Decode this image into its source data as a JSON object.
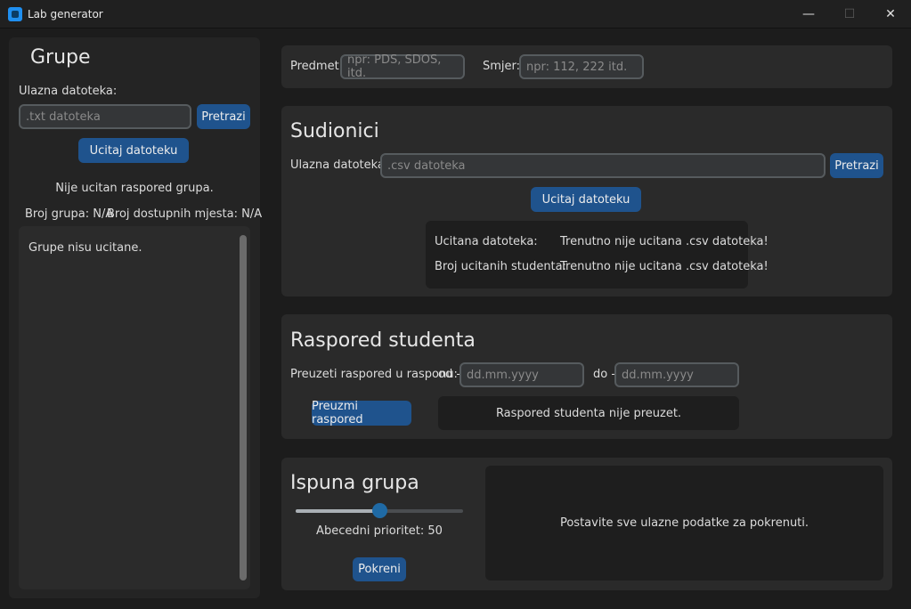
{
  "window": {
    "title": "Lab generator",
    "buttons": {
      "minimize": "—",
      "maximize": "☐",
      "close": "✕"
    }
  },
  "grupe": {
    "title": "Grupe",
    "input_label": "Ulazna datoteka:",
    "input_placeholder": ".txt datoteka",
    "browse_label": "Pretrazi",
    "load_label": "Ucitaj datoteku",
    "status": "Nije ucitan raspored grupa.",
    "count_groups": "Broj grupa: N/A",
    "count_slots": "Broj dostupnih mjesta: N/A",
    "list_text": "Grupe nisu ucitane."
  },
  "predmet": {
    "label": "Predmet:",
    "placeholder": "npr: PDS, SDOS, itd.",
    "smjer_label": "Smjer:",
    "smjer_placeholder": "npr: 112, 222 itd."
  },
  "sudionici": {
    "title": "Sudionici",
    "input_label": "Ulazna datoteka:",
    "input_placeholder": ".csv datoteka",
    "browse_label": "Pretrazi",
    "load_label": "Ucitaj datoteku",
    "info_loaded_label": "Ucitana datoteka:",
    "info_loaded_value": "Trenutno nije ucitana .csv datoteka!",
    "info_count_label": "Broj ucitanih studenta:",
    "info_count_value": "Trenutno nije ucitana .csv datoteka!"
  },
  "raspored": {
    "title": "Raspored studenta",
    "range_label": "Preuzeti raspored u rasponu:",
    "from_label": "od -",
    "from_placeholder": "dd.mm.yyyy",
    "to_label": "do -",
    "to_placeholder": "dd.mm.yyyy",
    "download_label": "Preuzmi raspored",
    "status": "Raspored studenta nije preuzet."
  },
  "ispuna": {
    "title": "Ispuna grupa",
    "slider_value": 50,
    "slider_max": 100,
    "priority_label": "Abecedni prioritet: 50",
    "run_label": "Pokreni",
    "message": "Postavite sve ulazne podatke za pokrenuti."
  },
  "colors": {
    "accent": "#1f538d",
    "knob": "#1f6aa5",
    "background": "#1c1c1c",
    "card": "#2a2a2a"
  }
}
